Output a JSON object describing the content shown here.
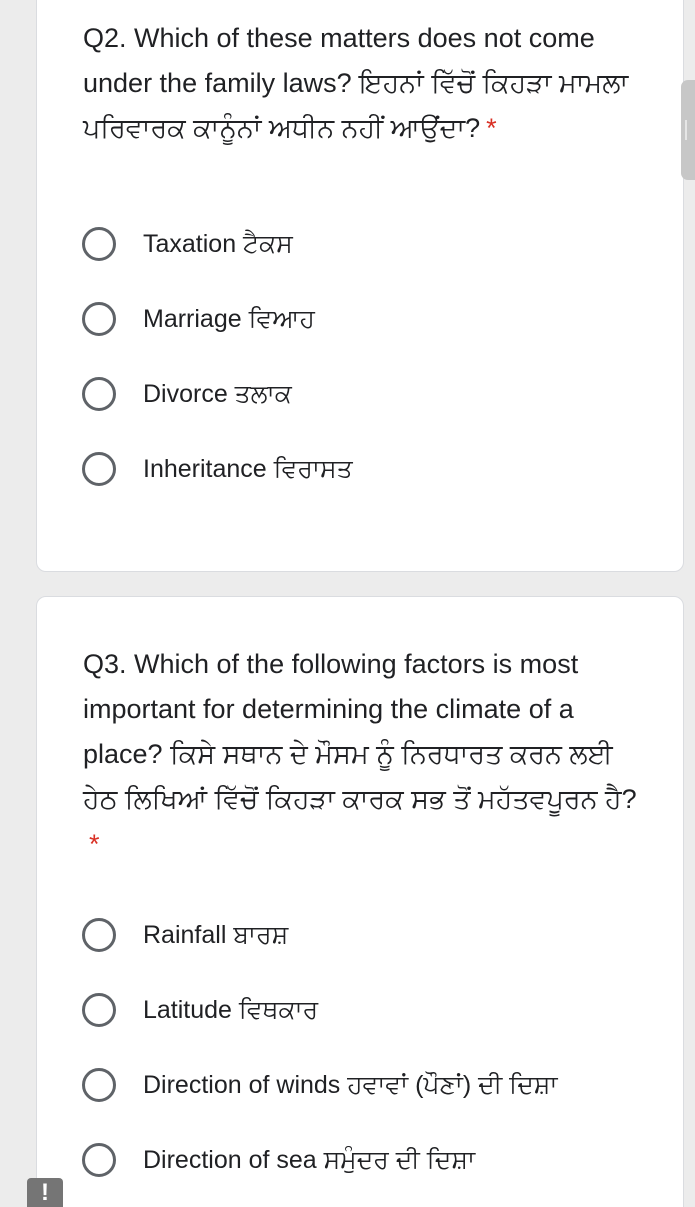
{
  "q2": {
    "question": "Q2. Which of these matters does not come under the family laws? ਇਹਨਾਂ ਵਿੱਚੋਂ ਕਿਹੜਾ ਮਾਮਲਾ ਪਰਿਵਾਰਕ ਕਾਨੂੰਨਾਂ ਅਧੀਨ ਨਹੀਂ ਆਉਂਦਾ?",
    "required_mark": "*",
    "options": [
      {
        "label": "Taxation ਟੈਕਸ"
      },
      {
        "label": "Marriage ਵਿਆਹ"
      },
      {
        "label": "Divorce ਤਲਾਕ"
      },
      {
        "label": "Inheritance ਵਿਰਾਸਤ"
      }
    ]
  },
  "q3": {
    "question": "Q3. Which of the following factors is most important for determining the climate of a place? ਕਿਸੇ ਸਥਾਨ ਦੇ ਮੌਸਮ ਨੂੰ ਨਿਰਧਾਰਤ ਕਰਨ ਲਈ ਹੇਠ ਲਿਖਿਆਂ ਵਿੱਚੋਂ ਕਿਹੜਾ ਕਾਰਕ ਸਭ ਤੋਂ ਮਹੱਤਵਪੂਰਨ ਹੈ?",
    "required_mark": "*",
    "options": [
      {
        "label": "Rainfall ਬਾਰਸ਼"
      },
      {
        "label": "Latitude ਵਿਥਕਾਰ"
      },
      {
        "label": "Direction of winds ਹਵਾਵਾਂ (ਪੌਣਾਂ) ਦੀ ਦਿਸ਼ਾ"
      },
      {
        "label": "Direction of sea ਸਮੁੰਦਰ ਦੀ ਦਿਸ਼ਾ"
      }
    ]
  },
  "report_button": {
    "label": "!"
  },
  "icons": {
    "radio": "radio-unchecked-icon",
    "report": "exclamation-icon"
  },
  "colors": {
    "required": "#d93025",
    "radio_border": "#5f6368",
    "text": "#202124"
  }
}
